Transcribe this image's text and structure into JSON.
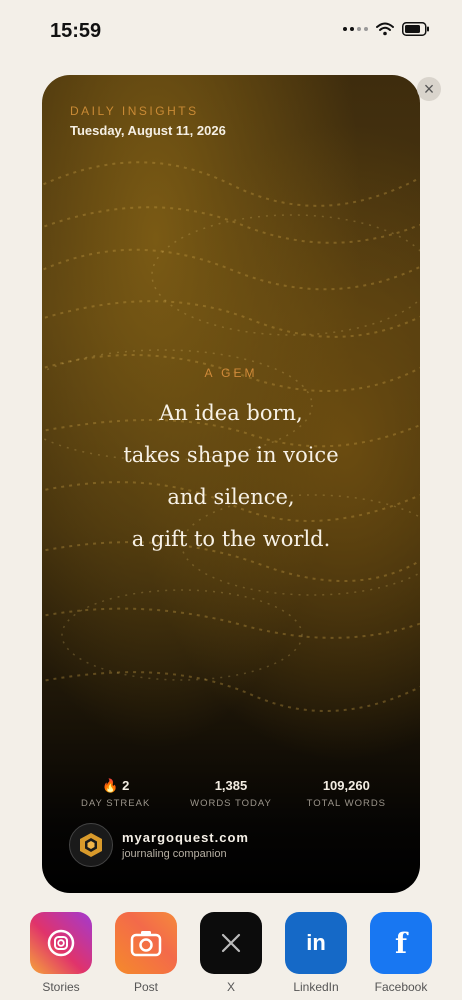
{
  "status": {
    "time": "15:59"
  },
  "card": {
    "eyebrow": "DAILY INSIGHTS",
    "date": "Tuesday, August 11, 2026",
    "gem_label": "A GEM",
    "poem": [
      "An idea born,",
      "takes shape in voice",
      "and silence,",
      "a gift to the world."
    ],
    "stats": {
      "streak": {
        "value": "2",
        "label": "DAY STREAK",
        "icon": "flame-icon"
      },
      "words_today": {
        "value": "1,385",
        "label": "WORDS TODAY"
      },
      "total_words": {
        "value": "109,260",
        "label": "TOTAL WORDS"
      }
    },
    "brand": {
      "url": "myargoquest.com",
      "tagline": "journaling companion"
    }
  },
  "close_icon": "×",
  "share": [
    {
      "label": "Stories",
      "icon": "instagram-icon"
    },
    {
      "label": "Post",
      "icon": "camera-icon"
    },
    {
      "label": "X",
      "icon": "x-logo-icon"
    },
    {
      "label": "LinkedIn",
      "icon": "linkedin-icon"
    },
    {
      "label": "Facebook",
      "icon": "facebook-icon"
    }
  ],
  "colors": {
    "accent": "#c98a35",
    "background": "#f3efe8"
  }
}
